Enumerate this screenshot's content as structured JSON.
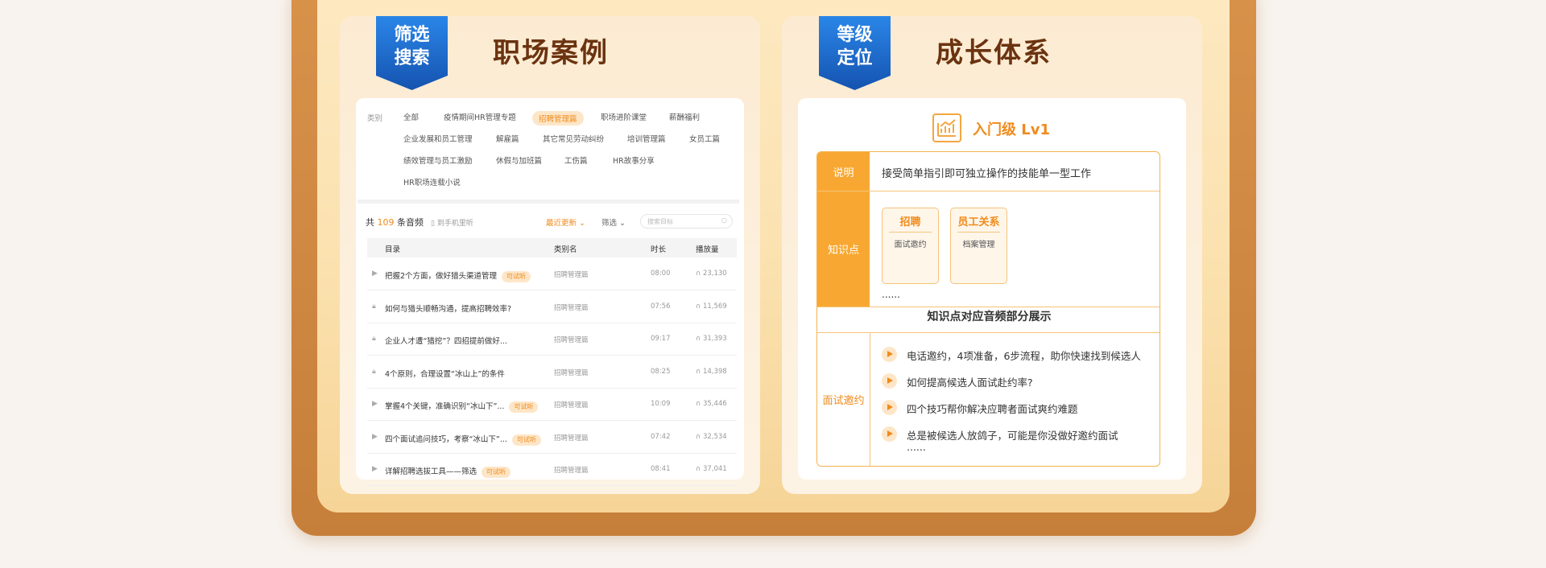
{
  "left_panel": {
    "ribbon": [
      "筛选",
      "搜索"
    ],
    "title": "职场案例",
    "filter_label": "类别",
    "filters": [
      [
        "全部",
        "疫情期间HR管理专题",
        "招聘管理篇",
        "职场进阶课堂",
        "薪酬福利"
      ],
      [
        "企业发展和员工管理",
        "解雇篇",
        "其它常见劳动纠纷",
        "培训管理篇",
        "女员工篇"
      ],
      [
        "绩效管理与员工激励",
        "休假与加班篇",
        "工伤篇",
        "HR故事分享"
      ],
      [
        "HR职场连载小说"
      ]
    ],
    "active_filter": "招聘管理篇",
    "count_prefix": "共",
    "count": "109",
    "count_suffix": "条音频",
    "phone_listen": "到手机里听",
    "sort_label": "最近更新",
    "filter_button": "筛选",
    "search_placeholder": "搜索目标",
    "columns": [
      "目录",
      "类别名",
      "时长",
      "播放量"
    ],
    "rows": [
      {
        "icon": "play",
        "title": "把握2个方面，做好猎头渠道管理",
        "try": "可试听",
        "category": "招聘管理篇",
        "duration": "08:00",
        "plays": "23,130"
      },
      {
        "icon": "lock",
        "title": "如何与猎头顺畅沟通，提高招聘效率?",
        "try": "",
        "category": "招聘管理篇",
        "duration": "07:56",
        "plays": "11,569"
      },
      {
        "icon": "lock",
        "title": "企业人才遭“猎挖”？四招提前做好...",
        "try": "",
        "category": "招聘管理篇",
        "duration": "09:17",
        "plays": "31,393"
      },
      {
        "icon": "lock",
        "title": "4个原则，合理设置“冰山上”的条件",
        "try": "",
        "category": "招聘管理篇",
        "duration": "08:25",
        "plays": "14,398"
      },
      {
        "icon": "play",
        "title": "掌握4个关键，准确识别“冰山下”...",
        "try": "可试听",
        "category": "招聘管理篇",
        "duration": "10:09",
        "plays": "35,446"
      },
      {
        "icon": "play",
        "title": "四个面试追问技巧，考察“冰山下”...",
        "try": "可试听",
        "category": "招聘管理篇",
        "duration": "07:42",
        "plays": "32,534"
      },
      {
        "icon": "play",
        "title": "详解招聘选拔工具——筛选",
        "try": "可试听",
        "category": "招聘管理篇",
        "duration": "08:41",
        "plays": "37,041"
      }
    ]
  },
  "right_panel": {
    "ribbon": [
      "等级",
      "定位"
    ],
    "title": "成长体系",
    "level_label": "入门级 Lv1",
    "desc_label": "说明",
    "desc_text": "接受简单指引即可独立操作的技能单一型工作",
    "knowledge_label": "知识点",
    "cards": [
      {
        "title": "招聘",
        "sub": "面试邀约"
      },
      {
        "title": "员工关系",
        "sub": "档案管理"
      }
    ],
    "ellipsis": "......",
    "audio_header": "知识点对应音频部分展示",
    "audio_label": "面试邀约",
    "audios": [
      "电话邀约，4项准备，6步流程，助你快速找到候选人",
      "如何提高候选人面试赴约率?",
      "四个技巧帮你解决应聘者面试爽约难题",
      "总是被候选人放鸽子，可能是你没做好邀约面试"
    ],
    "audio_ellipsis": "......"
  },
  "colors": {
    "accent": "#f08b1c",
    "ribbon": "#1f6fd0",
    "frame": "#c67f3a",
    "title": "#6b3310"
  }
}
